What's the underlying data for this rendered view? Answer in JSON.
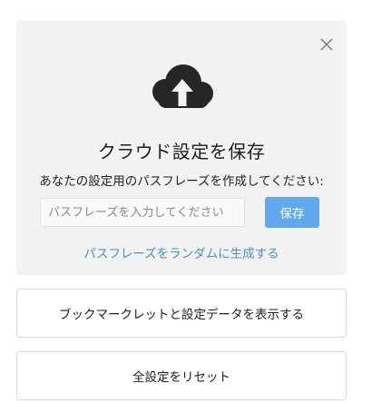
{
  "cloud_panel": {
    "close_icon": "close-icon",
    "cloud_icon": "cloud-upload-icon",
    "title": "クラウド設定を保存",
    "prompt": "あなたの設定用のパスフレーズを作成してください:",
    "passphrase_input": {
      "value": "",
      "placeholder": "パスフレーズを入力してください"
    },
    "save_label": "保存",
    "random_link": "パスフレーズをランダムに生成する",
    "accent_color": "#62a8ec",
    "link_color": "#4a90d0"
  },
  "actions": {
    "bookmarklet_label": "ブックマークレットと設定データを表示する",
    "reset_label": "全設定をリセット"
  }
}
